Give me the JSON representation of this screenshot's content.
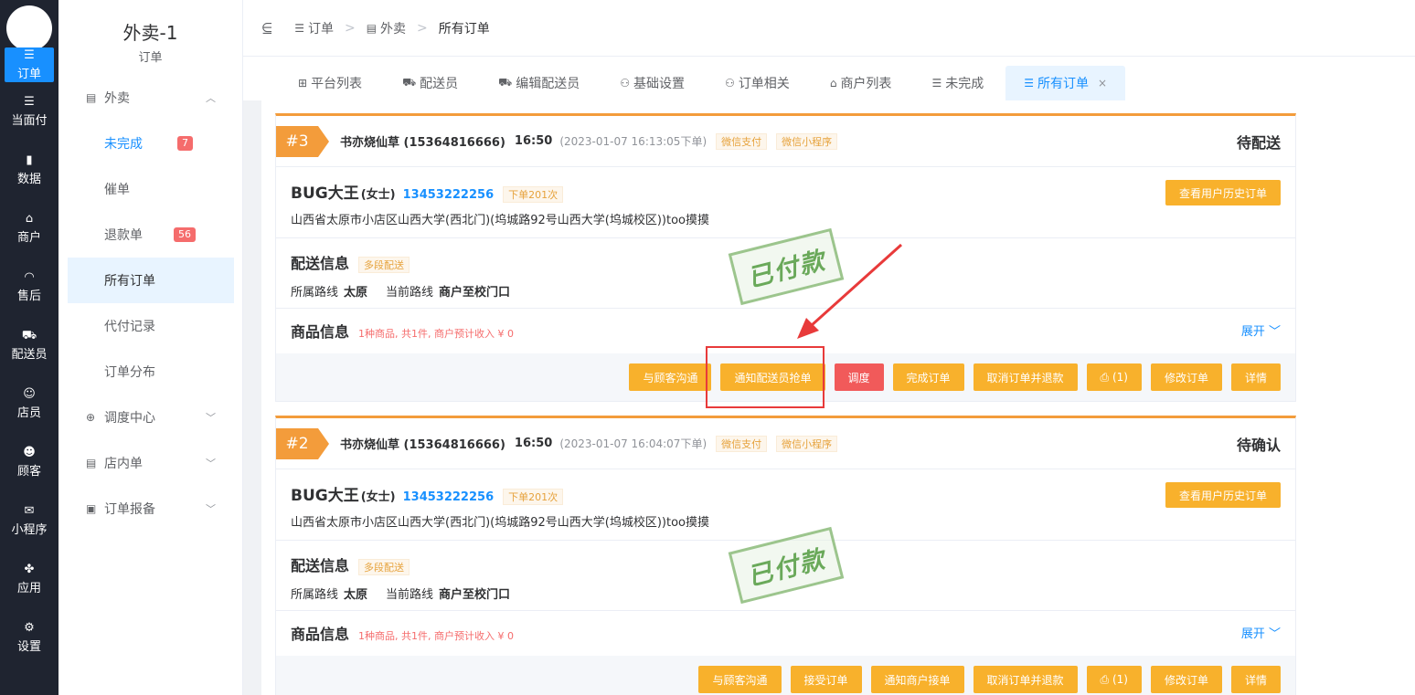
{
  "rail": {
    "items": [
      {
        "icon": "☰",
        "label": "订单"
      },
      {
        "icon": "☰",
        "label": "当面付"
      },
      {
        "icon": "▮",
        "label": "数据"
      },
      {
        "icon": "⌂",
        "label": "商户"
      },
      {
        "icon": "◠",
        "label": "售后"
      },
      {
        "icon": "⛟",
        "label": "配送员"
      },
      {
        "icon": "☺",
        "label": "店员"
      },
      {
        "icon": "☻",
        "label": "顾客"
      },
      {
        "icon": "✉",
        "label": "小程序"
      },
      {
        "icon": "✤",
        "label": "应用"
      },
      {
        "icon": "⚙",
        "label": "设置"
      }
    ]
  },
  "side": {
    "title": "外卖-1",
    "subtitle": "订单",
    "menu": {
      "takeout": "外卖",
      "unfinished": "未完成",
      "unfinished_count": "7",
      "urge": "催单",
      "refund": "退款单",
      "refund_count": "56",
      "all_orders": "所有订单",
      "proxy_pay": "代付记录",
      "distribution": "订单分布",
      "dispatch": "调度中心",
      "instore": "店内单",
      "report": "订单报备"
    }
  },
  "header": {
    "crumb1": "订单",
    "crumb2": "外卖",
    "crumb3": "所有订单"
  },
  "tabs": [
    {
      "icon": "⊞",
      "label": "平台列表"
    },
    {
      "icon": "⛟",
      "label": "配送员"
    },
    {
      "icon": "⛟",
      "label": "编辑配送员"
    },
    {
      "icon": "⚇",
      "label": "基础设置"
    },
    {
      "icon": "⚇",
      "label": "订单相关"
    },
    {
      "icon": "⌂",
      "label": "商户列表"
    },
    {
      "icon": "☰",
      "label": "未完成"
    },
    {
      "icon": "☰",
      "label": "所有订单",
      "close": "×"
    }
  ],
  "orders": [
    {
      "num": "#3",
      "shop": "书亦烧仙草 (15364816666)",
      "time": "16:50",
      "date": "(2023-01-07 16:13:05下单)",
      "tag1": "微信支付",
      "tag2": "微信小程序",
      "status": "待配送",
      "user_name": "BUG大王",
      "gender": "(女士)",
      "phone": "13453222256",
      "order_times": "下单201次",
      "address": "山西省太原市小店区山西大学(西北门)(坞城路92号山西大学(坞城校区))too摸摸",
      "history_btn": "查看用户历史订单",
      "deliv_title": "配送信息",
      "deliv_tag": "多段配送",
      "route_label": "所属路线",
      "route_val": "太原",
      "cur_route_label": "当前路线",
      "cur_route_val": "商户至校门口",
      "goods_title": "商品信息",
      "goods_summary": "1种商品, 共1件, 商户预计收入 ¥ 0",
      "expand": "展开 ﹀",
      "stamp": "已付款",
      "actions": [
        "与顾客沟通",
        "通知配送员抢单",
        "调度",
        "完成订单",
        "取消订单并退款",
        "⎙ (1)",
        "修改订单",
        "详情"
      ]
    },
    {
      "num": "#2",
      "shop": "书亦烧仙草 (15364816666)",
      "time": "16:50",
      "date": "(2023-01-07 16:04:07下单)",
      "tag1": "微信支付",
      "tag2": "微信小程序",
      "status": "待确认",
      "user_name": "BUG大王",
      "gender": "(女士)",
      "phone": "13453222256",
      "order_times": "下单201次",
      "address": "山西省太原市小店区山西大学(西北门)(坞城路92号山西大学(坞城校区))too摸摸",
      "history_btn": "查看用户历史订单",
      "deliv_title": "配送信息",
      "deliv_tag": "多段配送",
      "route_label": "所属路线",
      "route_val": "太原",
      "cur_route_label": "当前路线",
      "cur_route_val": "商户至校门口",
      "goods_title": "商品信息",
      "goods_summary": "1种商品, 共1件, 商户预计收入 ¥ 0",
      "expand": "展开 ﹀",
      "stamp": "已付款",
      "actions": [
        "与顾客沟通",
        "接受订单",
        "通知商户接单",
        "取消订单并退款",
        "⎙ (1)",
        "修改订单",
        "详情"
      ]
    }
  ],
  "colors": {
    "accent": "#1890ff",
    "button": "#f8b12c",
    "danger": "#f15a5a",
    "order_bar": "#f39c3b"
  }
}
